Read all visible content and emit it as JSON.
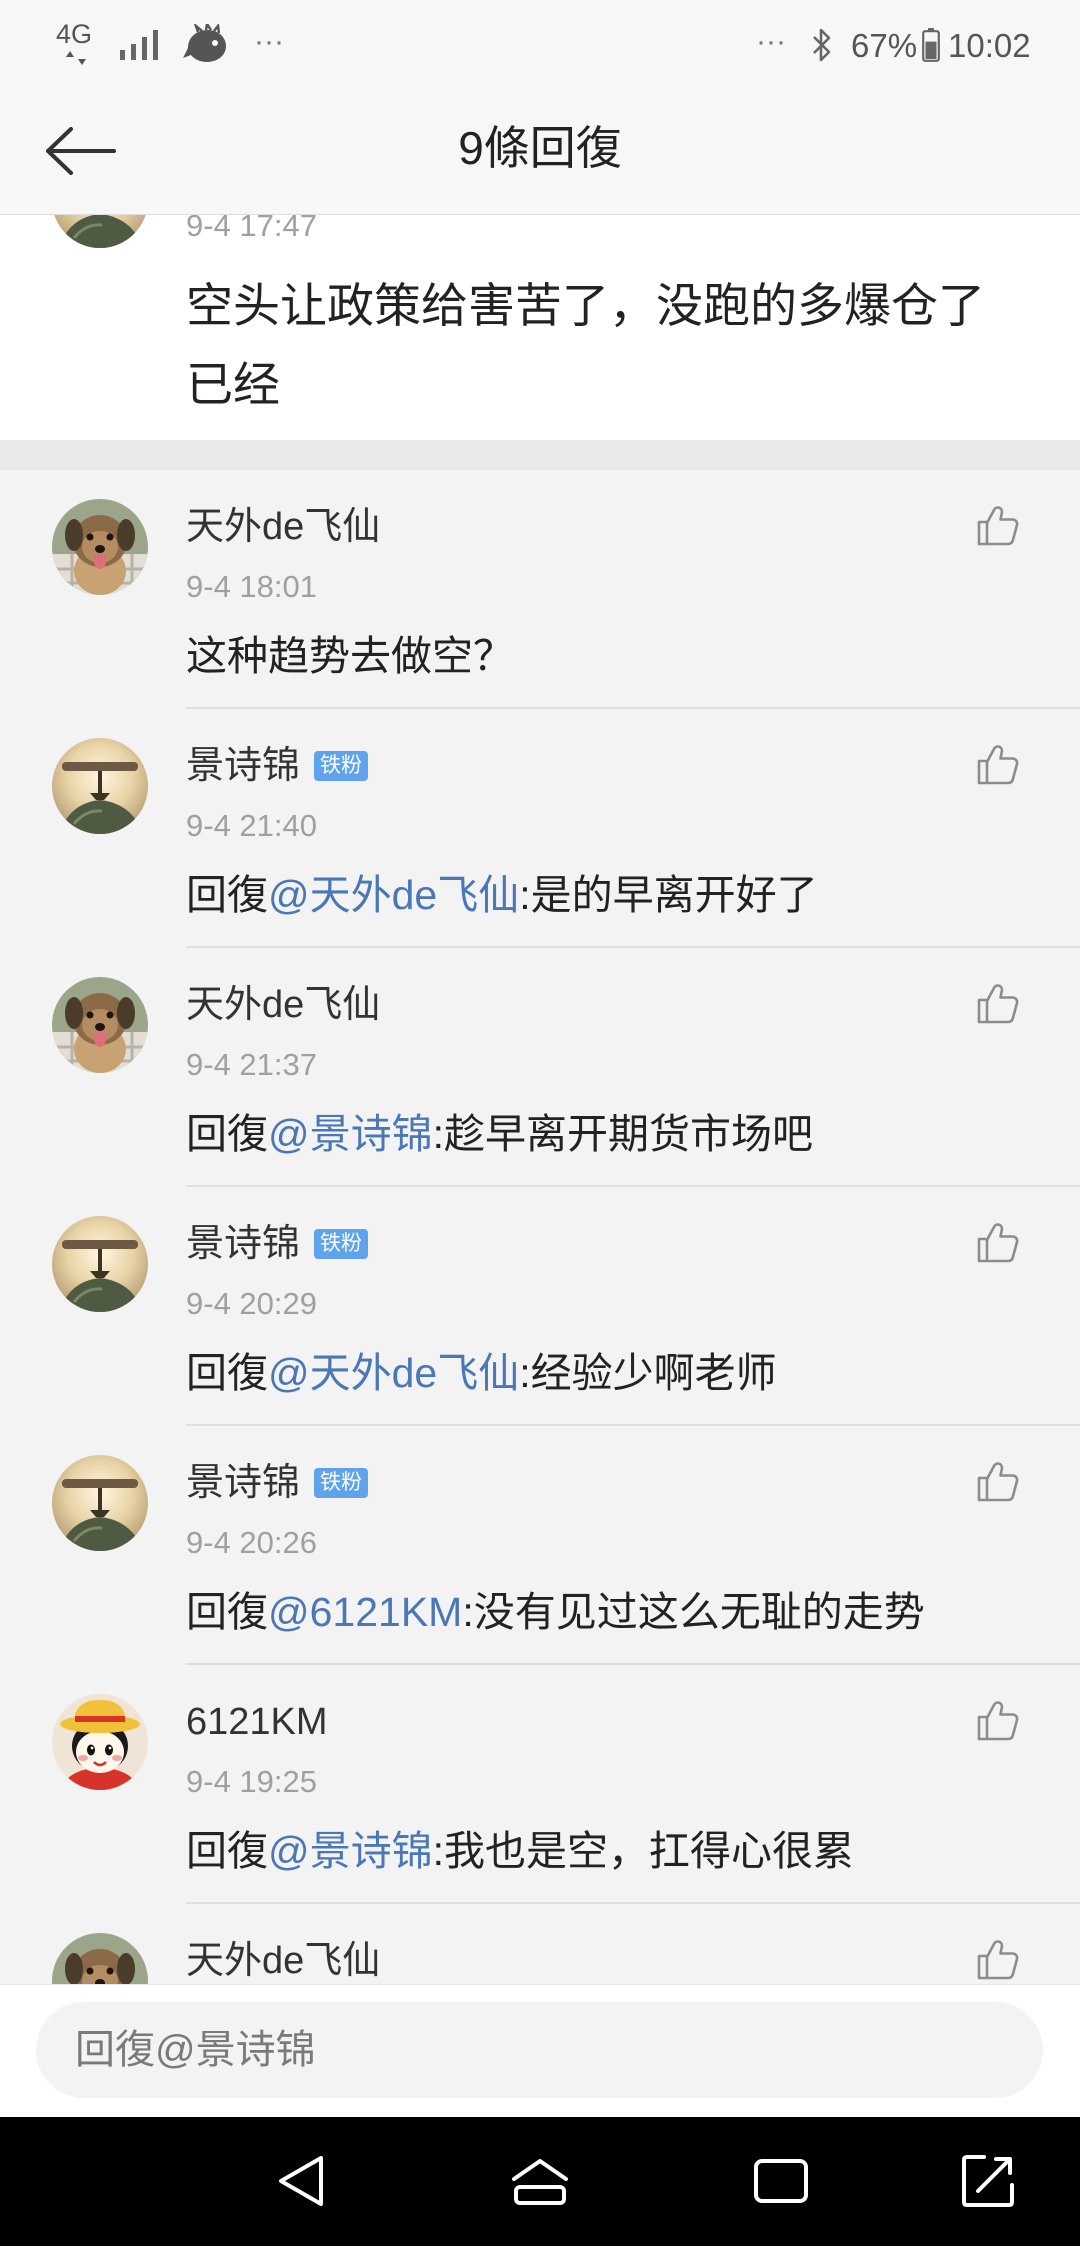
{
  "status_bar": {
    "network": "4G",
    "left_overflow": "···",
    "right_overflow": "···",
    "battery_percent": "67%",
    "time": "10:02",
    "icons": [
      "network-arrows-icon",
      "signal-strength-icon",
      "app-notification-icon",
      "bluetooth-icon",
      "battery-icon"
    ]
  },
  "header": {
    "title": "9條回復",
    "back_icon": "back-arrow-icon"
  },
  "root_comment": {
    "avatar": "lamp-photo-avatar",
    "time": "9-4 17:47",
    "text": "空头让政策给害苦了，没跑的多爆仓了已经"
  },
  "reply_like_icon": "thumbs-up-icon",
  "replies": [
    {
      "author": "天外de飞仙",
      "avatar": "dog-photo-avatar",
      "time": "9-4 18:01",
      "body": "这种趋势去做空？"
    },
    {
      "author": "景诗锦",
      "badge": "铁粉",
      "avatar": "lamp-photo-avatar",
      "time": "9-4 21:40",
      "prefix": "回復",
      "mention": "@天外de飞仙",
      "body": ":是的早离开好了"
    },
    {
      "author": "天外de飞仙",
      "avatar": "dog-photo-avatar",
      "time": "9-4 21:37",
      "prefix": "回復",
      "mention": "@景诗锦",
      "body": ":趁早离开期货市场吧"
    },
    {
      "author": "景诗锦",
      "badge": "铁粉",
      "avatar": "lamp-photo-avatar",
      "time": "9-4 20:29",
      "prefix": "回復",
      "mention": "@天外de飞仙",
      "body": ":经验少啊老师"
    },
    {
      "author": "景诗锦",
      "badge": "铁粉",
      "avatar": "lamp-photo-avatar",
      "time": "9-4 20:26",
      "prefix": "回復",
      "mention": "@6121KM",
      "body": ":没有见过这么无耻的走势"
    },
    {
      "author": "6121KM",
      "avatar": "cartoon-avatar",
      "time": "9-4 19:25",
      "prefix": "回復",
      "mention": "@景诗锦",
      "body": ":我也是空，扛得心很累"
    },
    {
      "author": "天外de飞仙",
      "avatar": "dog-photo-avatar"
    }
  ],
  "reply_box": {
    "placeholder": "回復@景诗锦"
  },
  "nav_bar": {
    "icons": [
      "nav-back-icon",
      "nav-home-icon",
      "nav-recents-icon",
      "nav-expand-icon"
    ]
  },
  "colors": {
    "mention": "#4a78b6",
    "badge": "#5ea3ec",
    "list_background": "#f3f3f3",
    "nav_bar": "#000000"
  }
}
